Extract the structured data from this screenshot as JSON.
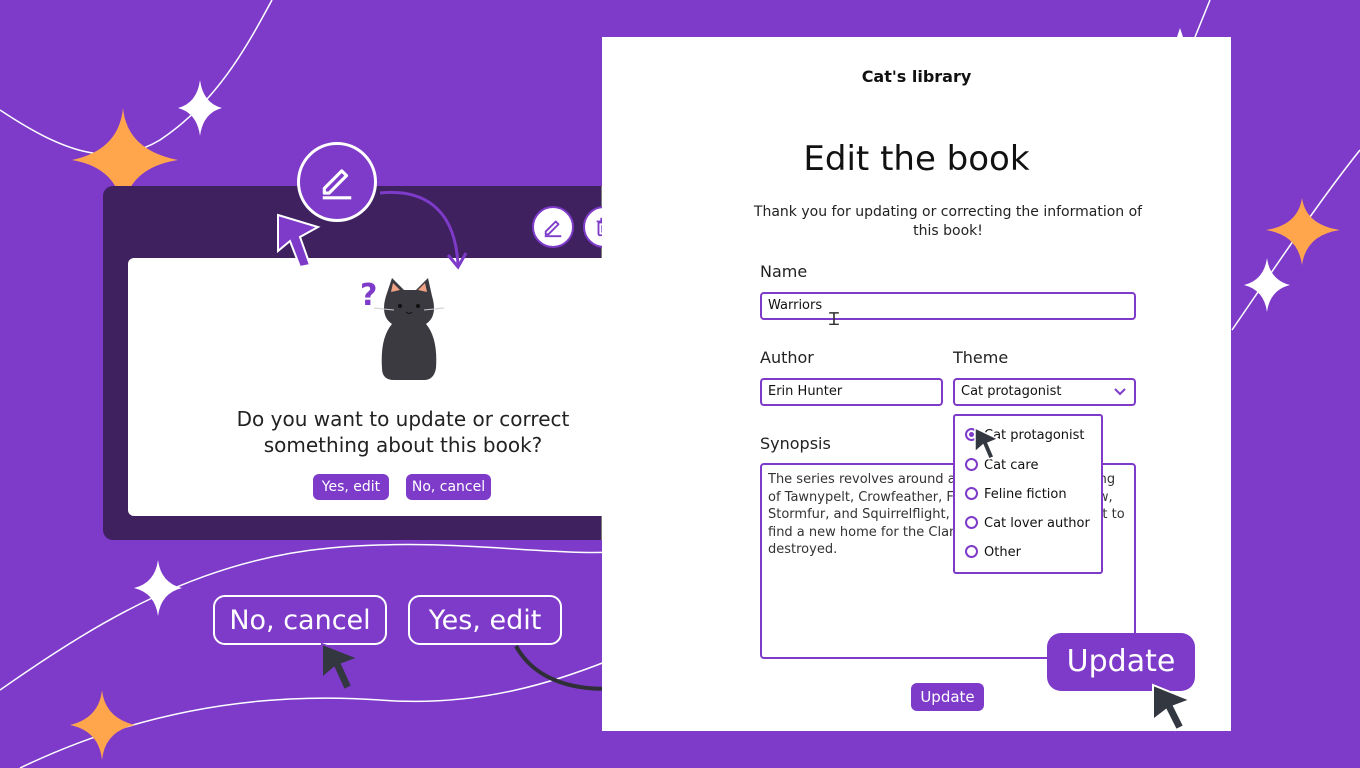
{
  "colors": {
    "accent": "#7e3bc9",
    "background": "#7e3bc9",
    "dark_card": "#3f2160",
    "sparkle": "#ffa64d"
  },
  "modal": {
    "question": "Do you want to update or correct something about this book?",
    "yes_label": "Yes, edit",
    "no_label": "No, cancel",
    "question_mark": "?"
  },
  "card_icons": [
    "pencil-icon",
    "trash-icon",
    "paw-icon"
  ],
  "callouts": {
    "no_cancel": "No, cancel",
    "yes_edit": "Yes, edit",
    "update": "Update"
  },
  "form": {
    "app_title": "Cat's library",
    "heading": "Edit the book",
    "intro": "Thank you for updating or correcting the information of this book!",
    "name_label": "Name",
    "name_value": "Warriors",
    "author_label": "Author",
    "author_value": "Erin Hunter",
    "theme_label": "Theme",
    "theme_value": "Cat protagonist",
    "synopsis_label": "Synopsis",
    "synopsis_value": "The series revolves around a group of cats consisting of Tawnypelt, Crowfeather, Feathertail, Brambleclaw, Stormfur, and Squirrelflight, who embark on a quest to find a new home for the Clans after their forest is destroyed.",
    "update_label": "Update",
    "theme_options": [
      {
        "label": "Cat protagonist",
        "selected": true
      },
      {
        "label": "Cat care",
        "selected": false
      },
      {
        "label": "Feline fiction",
        "selected": false
      },
      {
        "label": "Cat lover author",
        "selected": false
      },
      {
        "label": "Other",
        "selected": false
      }
    ]
  }
}
